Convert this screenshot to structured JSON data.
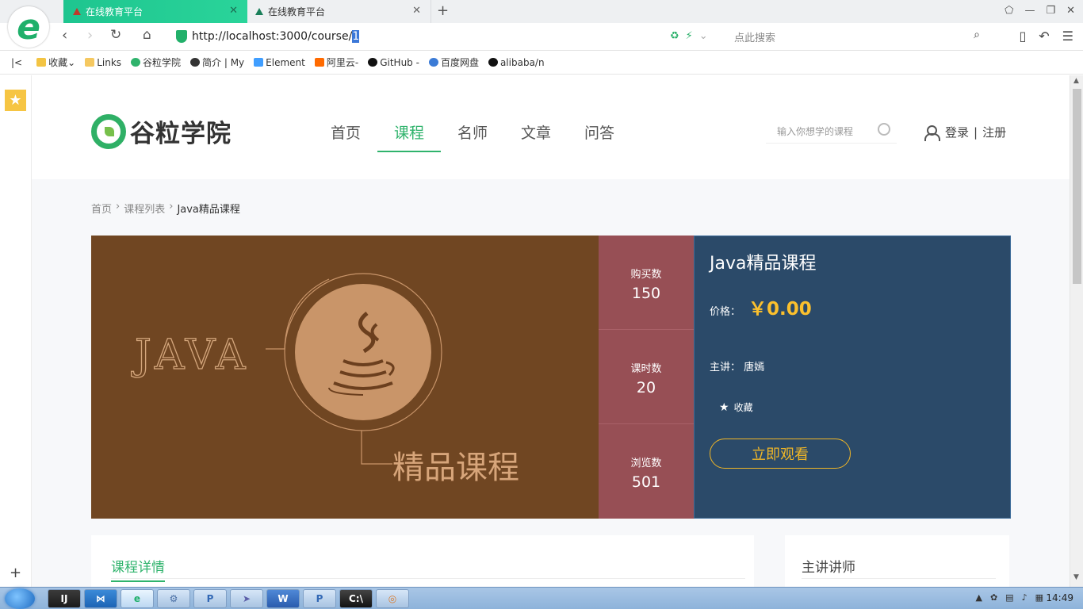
{
  "browser": {
    "tabs": [
      {
        "title": "在线教育平台"
      },
      {
        "title": "在线教育平台"
      }
    ],
    "url_prefix": "http://localhost:3000/course/",
    "url_selected": "1",
    "search_placeholder": "点此搜索",
    "bookmarks": [
      {
        "label": "收藏",
        "icon": "star-icon"
      },
      {
        "label": "Links",
        "icon": "folder-icon"
      },
      {
        "label": "谷粒学院",
        "icon": "guli-icon"
      },
      {
        "label": "简介 | My",
        "icon": "bird-icon"
      },
      {
        "label": "Element",
        "icon": "element-icon"
      },
      {
        "label": "阿里云-",
        "icon": "aliyun-icon"
      },
      {
        "label": "GitHub -",
        "icon": "github-icon"
      },
      {
        "label": "百度网盘",
        "icon": "baidu-icon"
      },
      {
        "label": "alibaba/n",
        "icon": "github-icon"
      }
    ]
  },
  "site": {
    "logo_text": "谷粒学院",
    "nav": [
      {
        "label": "首页",
        "active": false
      },
      {
        "label": "课程",
        "active": true
      },
      {
        "label": "名师",
        "active": false
      },
      {
        "label": "文章",
        "active": false
      },
      {
        "label": "问答",
        "active": false
      }
    ],
    "search_placeholder": "输入你想学的课程",
    "login": "登录",
    "separator": "|",
    "register": "注册"
  },
  "breadcrumb": [
    "首页",
    "课程列表",
    "Java精品课程"
  ],
  "cover": {
    "java_text": "JAVA",
    "subtitle": "精品课程"
  },
  "stats": [
    {
      "label": "购买数",
      "value": "150"
    },
    {
      "label": "课时数",
      "value": "20"
    },
    {
      "label": "浏览数",
      "value": "501"
    }
  ],
  "course": {
    "title": "Java精品课程",
    "price_label": "价格：",
    "price": "￥0.00",
    "teacher_label": "主讲：",
    "teacher": "唐嫣",
    "favorite": "收藏",
    "watch_button": "立即观看"
  },
  "lower": {
    "detail_tab": "课程详情",
    "teacher_heading": "主讲讲师"
  },
  "taskbar": {
    "clock": "14:49"
  },
  "colors": {
    "brand_green": "#2fb36c",
    "cover_bg": "#704622",
    "stats_bg": "#974f55",
    "info_bg": "#2b4a69",
    "price": "#fbc02d"
  }
}
